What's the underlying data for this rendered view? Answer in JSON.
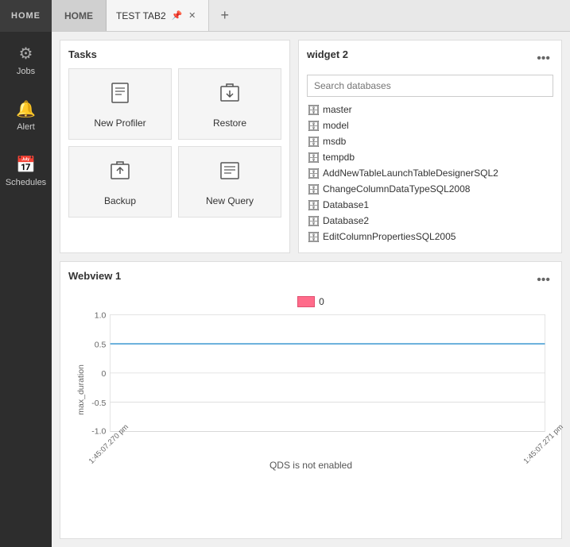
{
  "sidebar": {
    "home_label": "HOME",
    "items": [
      {
        "id": "jobs",
        "label": "Jobs",
        "icon": "⚙"
      },
      {
        "id": "alert",
        "label": "Alert",
        "icon": "🔔"
      },
      {
        "id": "schedules",
        "label": "Schedules",
        "icon": "📅"
      }
    ]
  },
  "tabbar": {
    "home_tab": "HOME",
    "active_tab": "TEST TAB2",
    "add_tab_icon": "+"
  },
  "tasks_widget": {
    "title": "Tasks",
    "items": [
      {
        "id": "new-profiler",
        "label": "New Profiler",
        "icon": "📋"
      },
      {
        "id": "restore",
        "label": "Restore",
        "icon": "🔄"
      },
      {
        "id": "backup",
        "label": "Backup",
        "icon": "⬆"
      },
      {
        "id": "new-query",
        "label": "New Query",
        "icon": "📄"
      }
    ]
  },
  "widget2": {
    "title": "widget 2",
    "menu_dots": "•••",
    "search_placeholder": "Search databases",
    "databases": [
      "master",
      "model",
      "msdb",
      "tempdb",
      "AddNewTableLaunchTableDesignerSQL2",
      "ChangeColumnDataTypeSQL2008",
      "Database1",
      "Database2",
      "EditColumnPropertiesSQL2005"
    ]
  },
  "webview": {
    "title": "Webview 1",
    "menu_dots": "•••",
    "legend_label": "0",
    "chart_subtitle": "QDS is not enabled",
    "x_labels": [
      "1:45:07.270 pm",
      "1:45:07.271 pm"
    ],
    "y_label": "max_duration",
    "y_ticks": [
      "1.0",
      "0.5",
      "0",
      "-0.5",
      "-1.0"
    ],
    "line_color": "#4a9fd4",
    "legend_color": "#ff6b8a"
  }
}
